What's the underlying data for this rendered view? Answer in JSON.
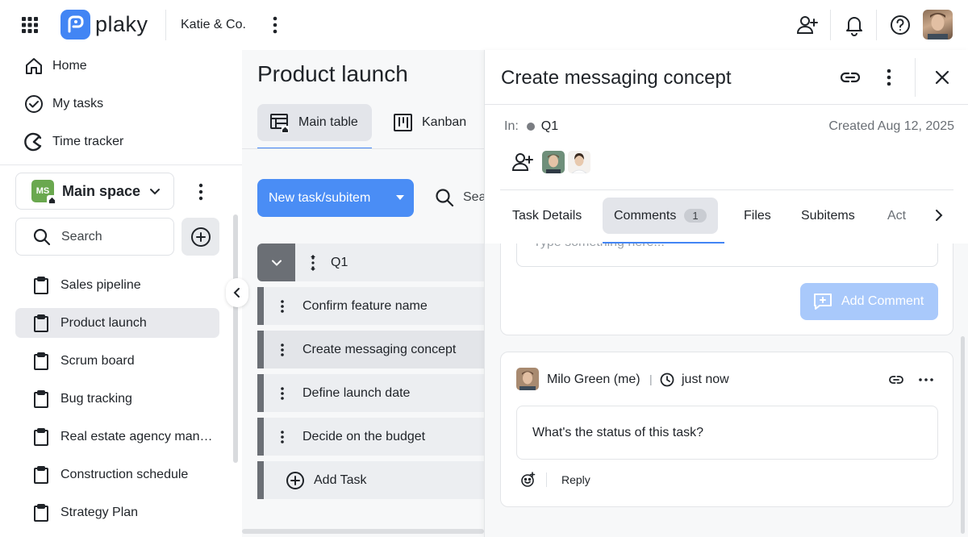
{
  "app": {
    "logo_text": "plaky",
    "workspace": "Katie & Co."
  },
  "sidebar": {
    "nav": [
      {
        "label": "Home",
        "icon": "home-icon"
      },
      {
        "label": "My tasks",
        "icon": "check-circle-icon"
      },
      {
        "label": "Time tracker",
        "icon": "time-tracker-icon"
      }
    ],
    "space": {
      "badge": "MS",
      "name": "Main space"
    },
    "search_placeholder": "Search",
    "boards": [
      {
        "label": "Sales pipeline"
      },
      {
        "label": "Product launch",
        "active": true
      },
      {
        "label": "Scrum board"
      },
      {
        "label": "Bug tracking"
      },
      {
        "label": "Real estate agency man…"
      },
      {
        "label": "Construction schedule"
      },
      {
        "label": "Strategy Plan"
      }
    ]
  },
  "board": {
    "title": "Product launch",
    "views": [
      {
        "label": "Main table",
        "active": true
      },
      {
        "label": "Kanban"
      }
    ],
    "new_task_label": "New task/subitem",
    "search_label": "Sea",
    "group": {
      "name": "Q1"
    },
    "tasks": [
      {
        "name": "Confirm feature name"
      },
      {
        "name": "Create messaging concept",
        "active": true
      },
      {
        "name": "Define launch date"
      },
      {
        "name": "Decide on the budget"
      }
    ],
    "add_task_label": "Add Task"
  },
  "detail": {
    "title": "Create messaging concept",
    "in_label": "In:",
    "group": "Q1",
    "created": "Created Aug 12, 2025",
    "tabs": [
      {
        "label": "Task Details"
      },
      {
        "label": "Comments",
        "count": "1",
        "active": true
      },
      {
        "label": "Files"
      },
      {
        "label": "Subitems"
      },
      {
        "label": "Act"
      }
    ],
    "comment_placeholder": "Type something here...",
    "add_comment_label": "Add Comment",
    "comment": {
      "author": "Milo Green (me)",
      "separator": "|",
      "time": "just now",
      "text": "What's the status of this task?",
      "reply_label": "Reply"
    }
  },
  "colors": {
    "accent": "#4285f4",
    "button": "#4a8df5",
    "button_disabled": "#a9c9fb",
    "space_badge": "#6aa84f",
    "group_bar": "#6b6f75"
  }
}
